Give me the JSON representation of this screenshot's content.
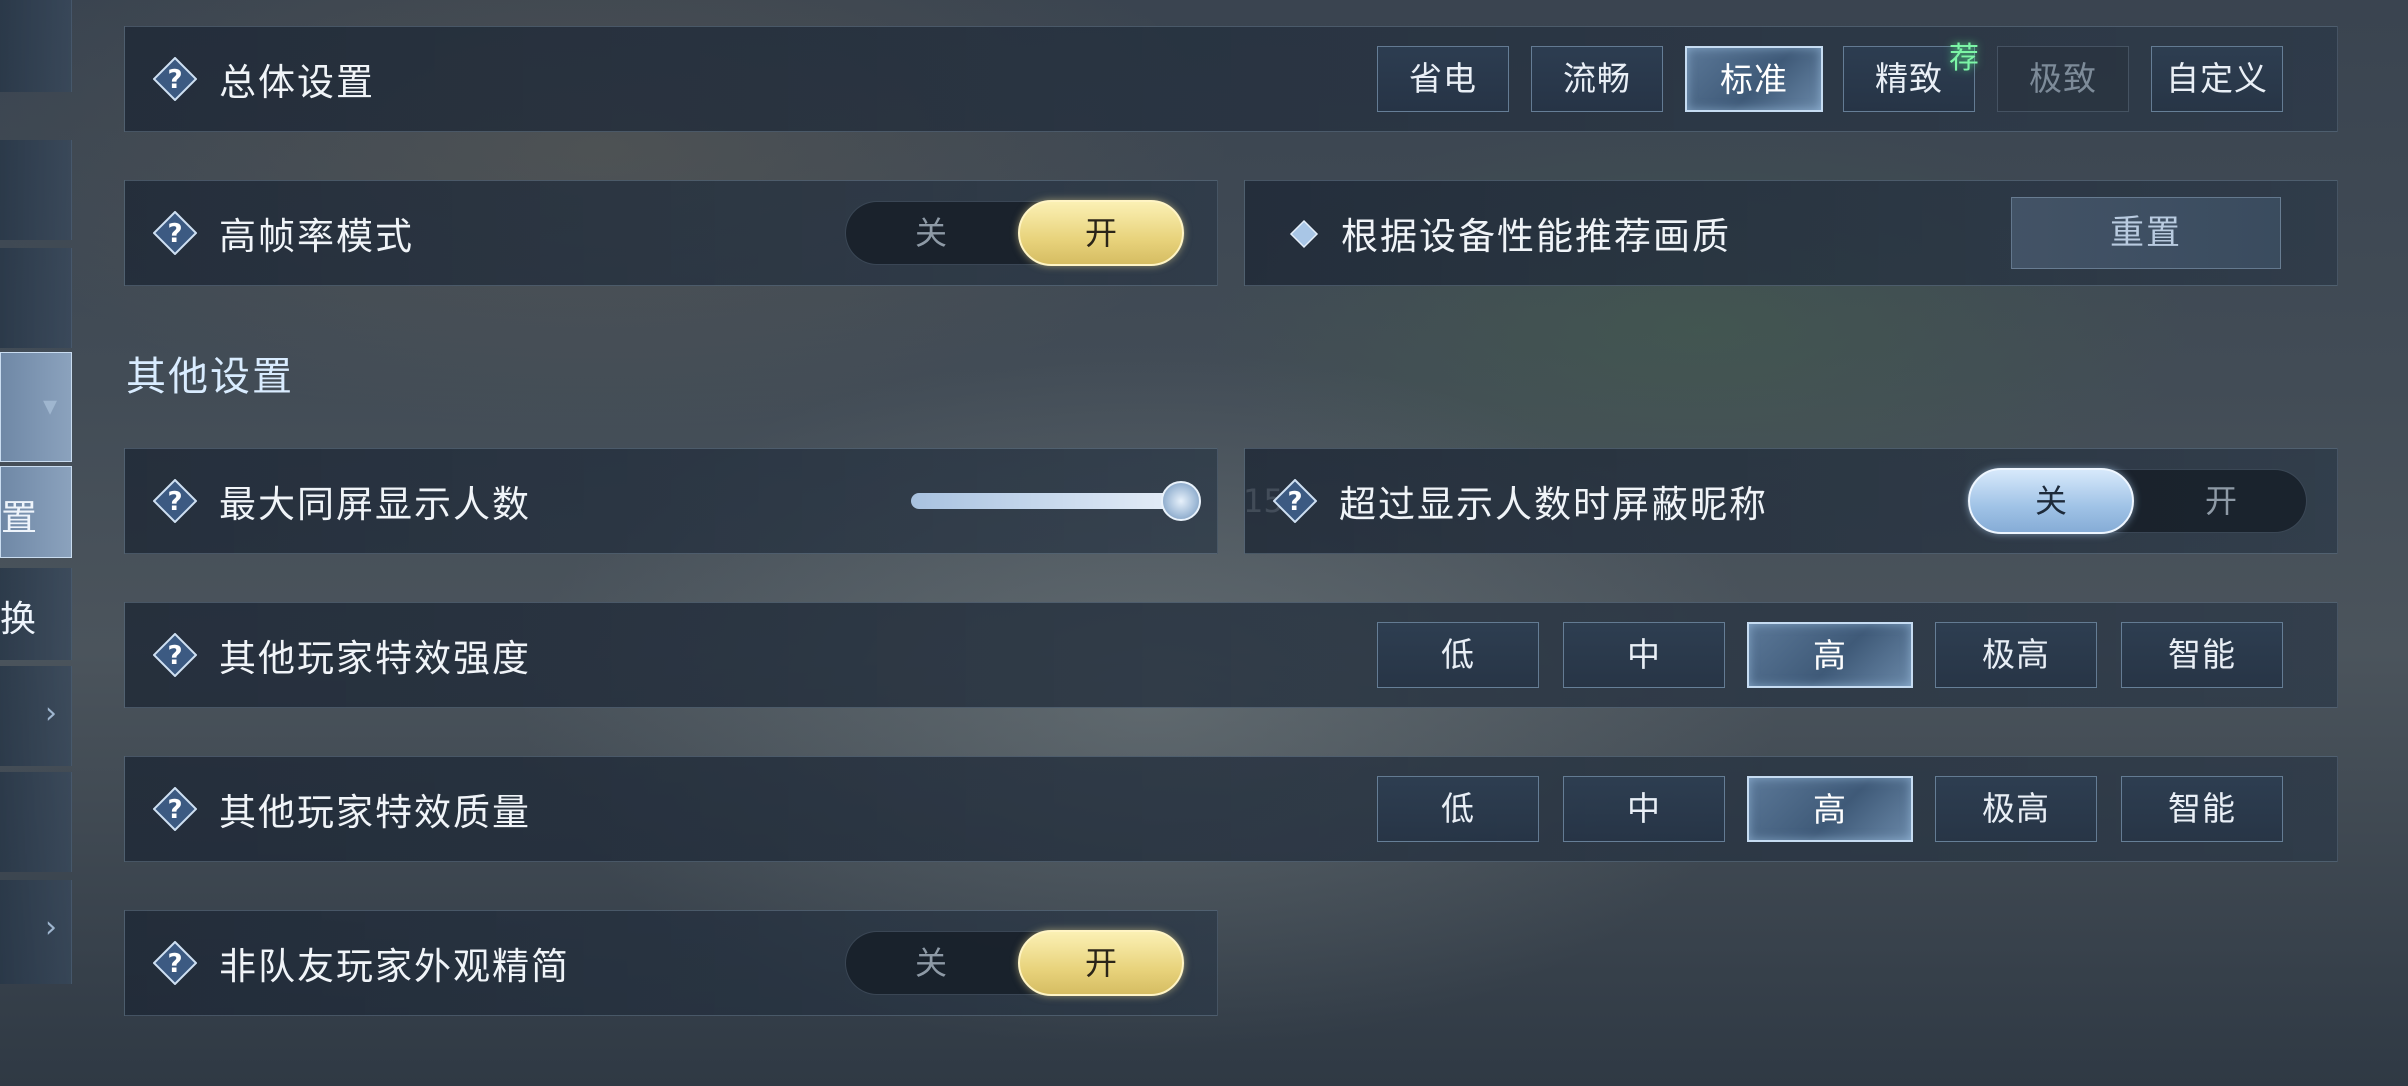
{
  "colors": {
    "accent_selected": "#5b7898",
    "toggle_gold": "#e8d37c",
    "toggle_blue": "#9fc2e6",
    "badge_green": "#7cf5a6",
    "section_title": "#d9ecff"
  },
  "sidebar": {
    "items": [
      {
        "label": ""
      },
      {
        "label": ""
      },
      {
        "label": ""
      },
      {
        "label": "",
        "icon": "chevron-down-icon"
      },
      {
        "label": "置"
      },
      {
        "label": "换"
      },
      {
        "label": "",
        "icon": "chevron-right-icon"
      },
      {
        "label": ""
      },
      {
        "label": "",
        "icon": "chevron-right-icon"
      }
    ]
  },
  "overall": {
    "label": "总体设置",
    "options": [
      "省电",
      "流畅",
      "标准",
      "精致",
      "极致",
      "自定义"
    ],
    "selected": "标准",
    "recommended_badge": "荐"
  },
  "high_fps": {
    "label": "高帧率模式",
    "off_label": "关",
    "on_label": "开",
    "value": "开"
  },
  "recommend": {
    "label": "根据设备性能推荐画质",
    "button_label": "重置"
  },
  "other_section": {
    "title": "其他设置"
  },
  "max_players": {
    "label": "最大同屏显示人数",
    "value": "15",
    "fraction": 1.0
  },
  "hide_names": {
    "label": "超过显示人数时屏蔽昵称",
    "off_label": "关",
    "on_label": "开",
    "value": "关"
  },
  "effects_strength": {
    "label": "其他玩家特效强度",
    "options": [
      "低",
      "中",
      "高",
      "极高",
      "智能"
    ],
    "selected": "高"
  },
  "effects_quality": {
    "label": "其他玩家特效质量",
    "options": [
      "低",
      "中",
      "高",
      "极高",
      "智能"
    ],
    "selected": "高"
  },
  "simplify_appearance": {
    "label": "非队友玩家外观精简",
    "off_label": "关",
    "on_label": "开",
    "value": "开"
  }
}
